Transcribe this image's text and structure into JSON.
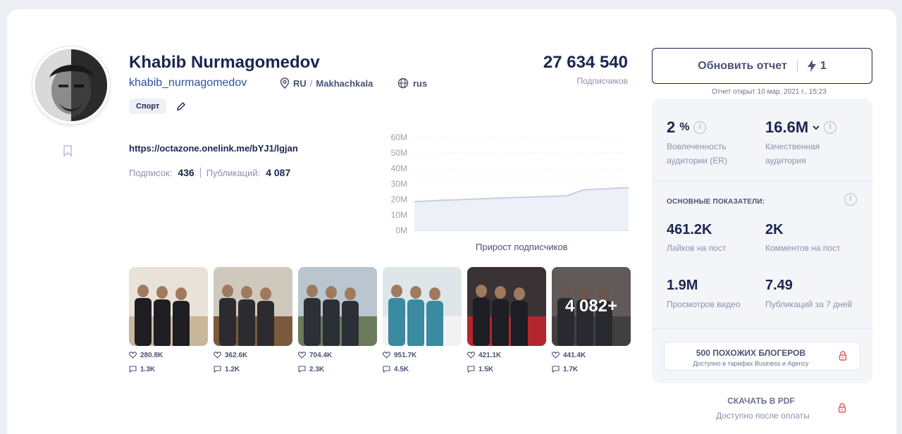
{
  "profile": {
    "name": "Khabib Nurmagomedov",
    "handle": "khabib_nurmagomedov",
    "country": "RU",
    "loc_sep": "/",
    "city": "Makhachkala",
    "language": "rus",
    "tag": "Спорт",
    "link": "https://octazone.onelink.me/bYJ1/lgjan",
    "following_label": "Подписок:",
    "following": "436",
    "posts_label": "Публикаций:",
    "posts": "4 087"
  },
  "followers": {
    "value": "27 634 540",
    "label": "Подписчиков"
  },
  "chart_data": {
    "type": "area",
    "title": "Прирост подписчиков",
    "yticks": [
      "60M",
      "50M",
      "40M",
      "30M",
      "20M",
      "10M",
      "0M"
    ],
    "ylim": [
      0,
      60
    ],
    "x": [
      0,
      1,
      2,
      3,
      4,
      5,
      6,
      7,
      8,
      9,
      10,
      11,
      12,
      13,
      14
    ],
    "values": [
      18.5,
      19,
      19.5,
      19.8,
      20.2,
      20.6,
      21,
      21.3,
      21.7,
      22,
      22.4,
      26,
      26.6,
      27.1,
      27.6
    ],
    "color": "#c9cde6"
  },
  "posts": [
    {
      "likes": "280.8K",
      "comments": "1.3K",
      "overlay": ""
    },
    {
      "likes": "362.6K",
      "comments": "1.2K",
      "overlay": ""
    },
    {
      "likes": "704.4K",
      "comments": "2.3K",
      "overlay": ""
    },
    {
      "likes": "951.7K",
      "comments": "4.5K",
      "overlay": ""
    },
    {
      "likes": "421.1K",
      "comments": "1.5K",
      "overlay": ""
    },
    {
      "likes": "441.4K",
      "comments": "1.7K",
      "overlay": "4 082+"
    }
  ],
  "report": {
    "refresh_label": "Обновить отчет",
    "refresh_count": "1",
    "opened": "Отчет открыт 10 мар. 2021 г., 15:23"
  },
  "panel": {
    "er_value": "2",
    "er_unit": "%",
    "er_label_1": "Вовлеченность",
    "er_label_2": "аудитории (ER)",
    "qa_value": "16.6M",
    "qa_label_1": "Качественная",
    "qa_label_2": "аудитория",
    "section_title": "ОСНОВНЫЕ ПОКАЗАТЕЛИ:",
    "likes_value": "461.2K",
    "likes_label": "Лайков на пост",
    "comments_value": "2K",
    "comments_label": "Комментов на пост",
    "views_value": "1.9M",
    "views_label": "Просмотров видео",
    "pubs_value": "7.49",
    "pubs_label": "Публикаций за 7 дней",
    "similar_title": "500 ПОХОЖИХ БЛОГЕРОВ",
    "similar_sub": "Доступно в тарифах Business и Agency"
  },
  "pdf": {
    "title": "СКАЧАТЬ В PDF",
    "sub": "Доступно после оплаты"
  }
}
